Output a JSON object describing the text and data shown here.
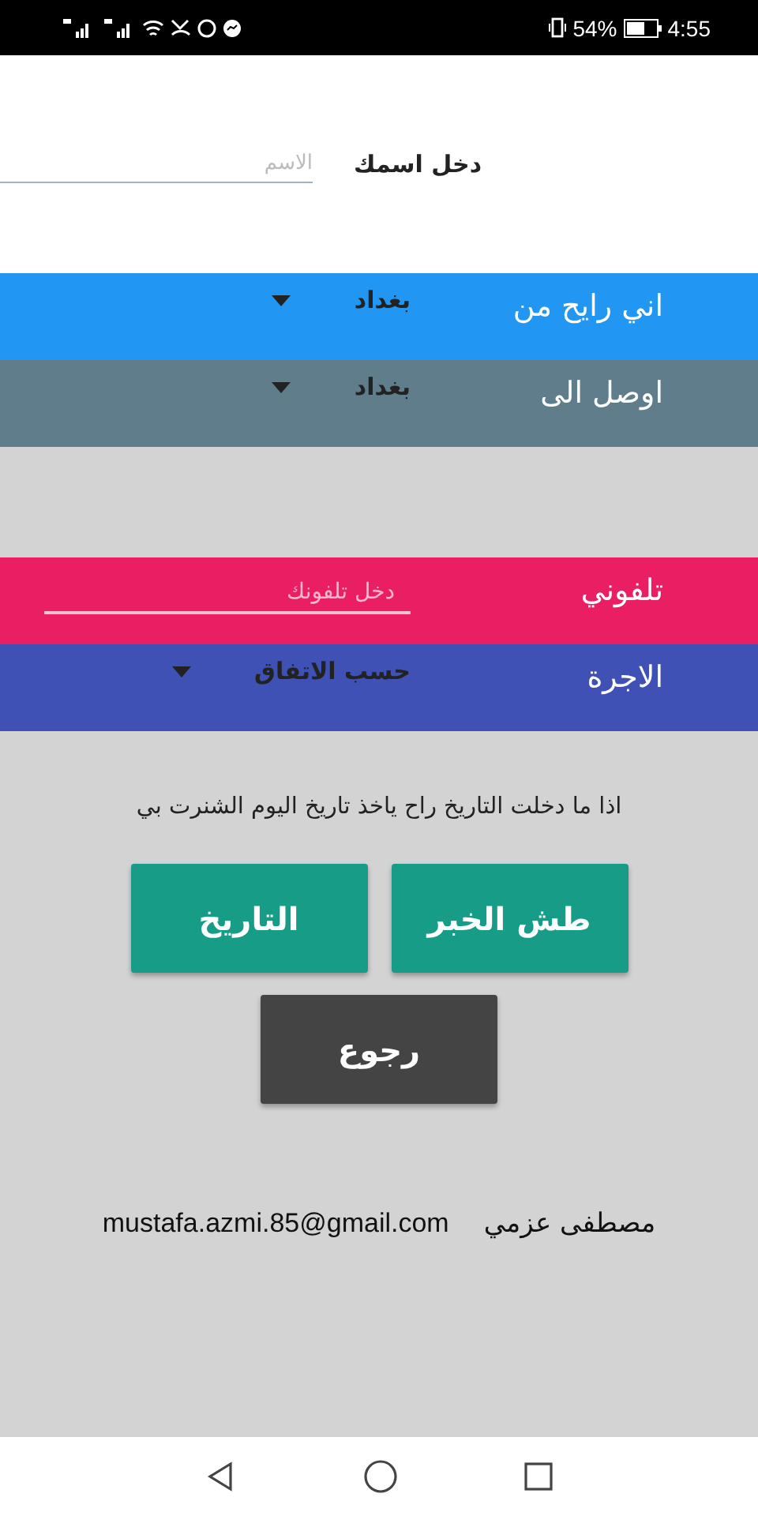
{
  "status_bar": {
    "battery": "54%",
    "time": "4:55"
  },
  "name_row": {
    "label": "دخل اسمك",
    "placeholder": "الاسم"
  },
  "route_rows": [
    {
      "kind": "dropdown",
      "label": "اني رايح من",
      "value": "بغداد",
      "color": "#2196f3"
    },
    {
      "kind": "dropdown",
      "label": "اوصل الى",
      "value": "بغداد",
      "color": "#607d8b"
    }
  ],
  "detail_rows": [
    {
      "kind": "field",
      "label": "تلفوني",
      "placeholder": "دخل تلفونك",
      "color": "#e91e63"
    },
    {
      "kind": "dropdown",
      "label": "الاجرة",
      "value": "حسب الاتفاق",
      "color": "#3f51b5"
    }
  ],
  "note": "اذا ما دخلت التاريخ راح ياخذ تاريخ اليوم الشنرت بي",
  "buttons": [
    {
      "kind": "teal",
      "label": "طش الخبر"
    },
    {
      "kind": "teal",
      "label": "التاريخ"
    },
    {
      "kind": "dark",
      "label": "رجوع"
    }
  ],
  "contact": {
    "name": "مصطفى عزمي",
    "email": "mustafa.azmi.85@gmail.com"
  }
}
